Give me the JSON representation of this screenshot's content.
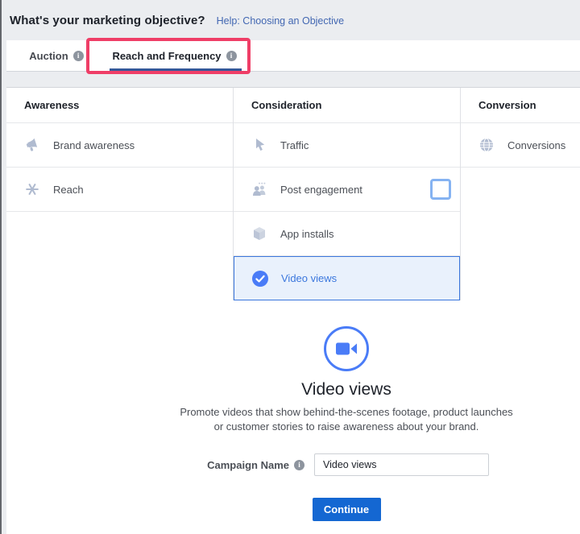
{
  "header": {
    "title": "What's your marketing objective?",
    "help_link": "Help: Choosing an Objective"
  },
  "tabs": {
    "auction": {
      "label": "Auction",
      "active": false
    },
    "reach_frequency": {
      "label": "Reach and Frequency",
      "active": true
    }
  },
  "objective_table": {
    "columns": [
      {
        "header": "Awareness",
        "items": [
          {
            "label": "Brand awareness",
            "icon": "megaphone-icon",
            "selected": false
          },
          {
            "label": "Reach",
            "icon": "reach-icon",
            "selected": false
          }
        ]
      },
      {
        "header": "Consideration",
        "items": [
          {
            "label": "Traffic",
            "icon": "cursor-icon",
            "selected": false
          },
          {
            "label": "Post engagement",
            "icon": "people-icon",
            "selected": false,
            "has_checkbox": true
          },
          {
            "label": "App installs",
            "icon": "cube-icon",
            "selected": false
          },
          {
            "label": "Video views",
            "icon": "check-circle-icon",
            "selected": true
          }
        ]
      },
      {
        "header": "Conversion",
        "items": [
          {
            "label": "Conversions",
            "icon": "globe-icon",
            "selected": false
          }
        ]
      }
    ]
  },
  "detail": {
    "icon": "video-camera-icon",
    "title": "Video views",
    "description_line1": "Promote videos that show behind-the-scenes footage, product launches",
    "description_line2": "or customer stories to raise awareness about your brand.",
    "campaign_label": "Campaign Name",
    "campaign_value": "Video views",
    "continue_label": "Continue"
  },
  "icons": {
    "info_glyph": "i"
  },
  "colors": {
    "accent_blue": "#3b77dd",
    "selected_row_bg": "#e9f1fc",
    "annotation_pink": "#ef3e67",
    "button_blue": "#1467d2",
    "link_blue": "#4267b2",
    "tab_underline_blue": "#365899",
    "icon_gray_blue": "#b0bbd0",
    "page_gray": "#ebedf0"
  }
}
